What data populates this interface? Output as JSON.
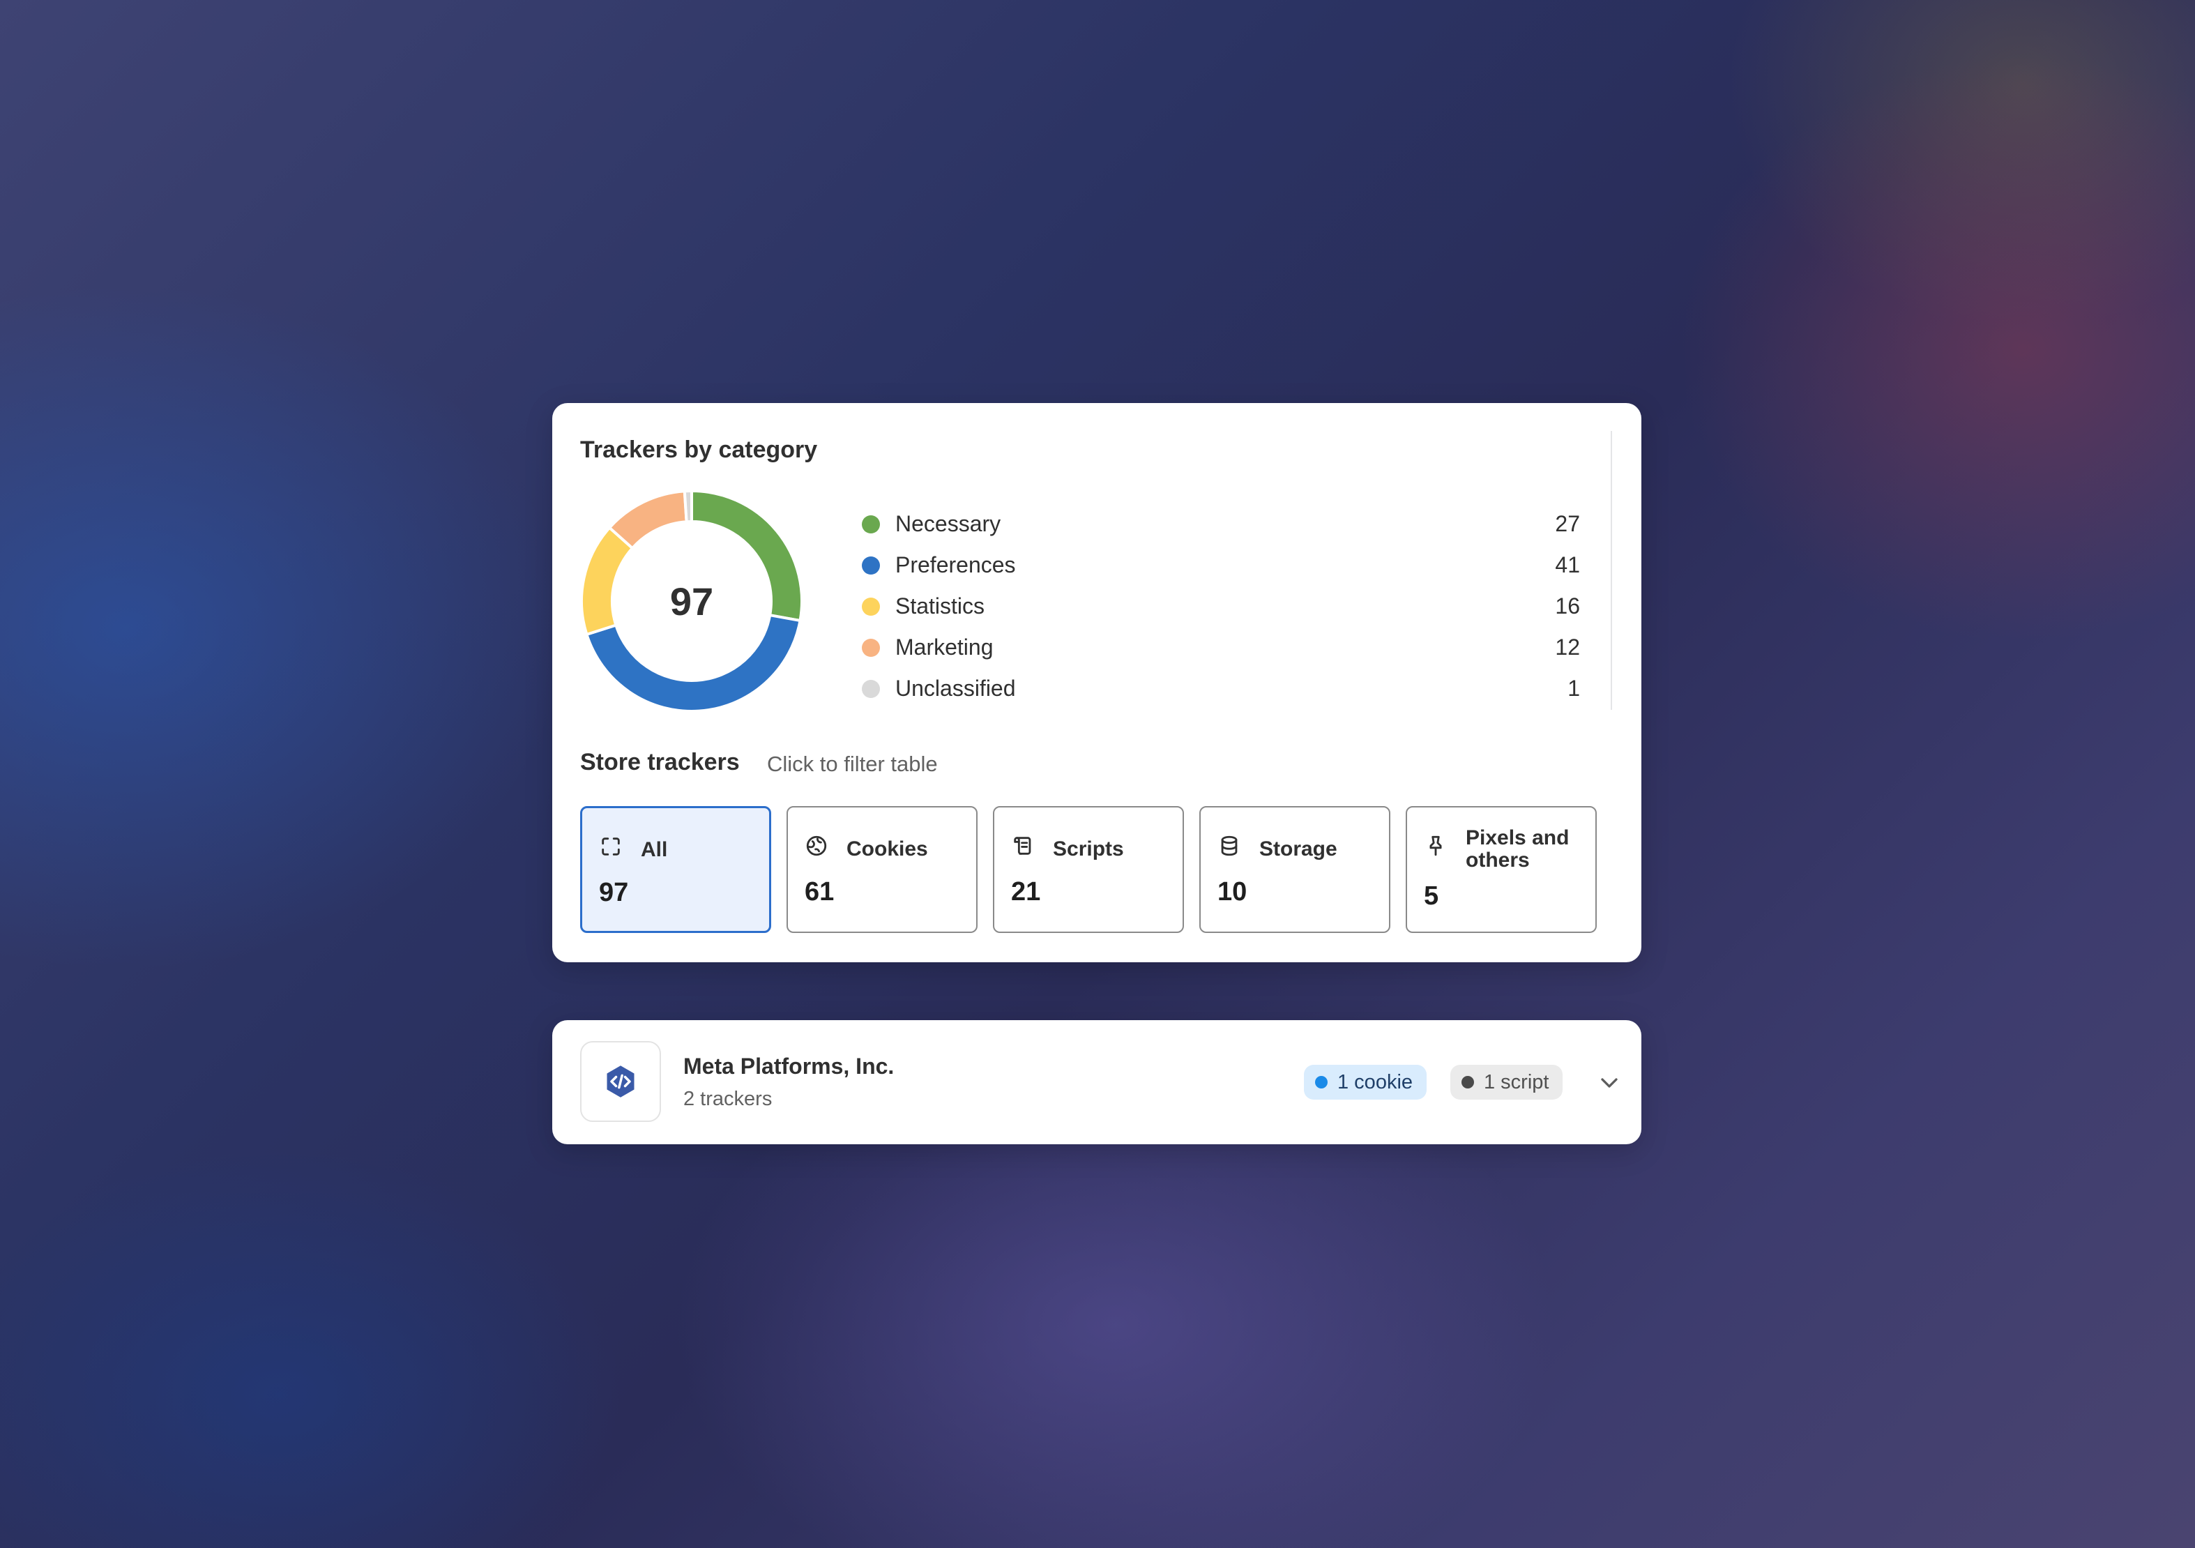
{
  "summary": {
    "title": "Trackers by category",
    "total": "97",
    "categories": [
      {
        "label": "Necessary",
        "count": "27",
        "value": 27,
        "color": "#6aa84f"
      },
      {
        "label": "Preferences",
        "count": "41",
        "value": 41,
        "color": "#2e73c4"
      },
      {
        "label": "Statistics",
        "count": "16",
        "value": 16,
        "color": "#fdd35c"
      },
      {
        "label": "Marketing",
        "count": "12",
        "value": 12,
        "color": "#f8b382"
      },
      {
        "label": "Unclassified",
        "count": "1",
        "value": 1,
        "color": "#d9d9d9"
      }
    ]
  },
  "store": {
    "title": "Store trackers",
    "hint": "Click to filter table",
    "tiles": [
      {
        "label": "All",
        "count": "97",
        "icon": "all-bracket-icon",
        "selected": true
      },
      {
        "label": "Cookies",
        "count": "61",
        "icon": "cookie-icon",
        "selected": false
      },
      {
        "label": "Scripts",
        "count": "21",
        "icon": "script-scroll-icon",
        "selected": false
      },
      {
        "label": "Storage",
        "count": "10",
        "icon": "database-icon",
        "selected": false
      },
      {
        "label": "Pixels and others",
        "count": "5",
        "icon": "pin-icon",
        "selected": false
      }
    ]
  },
  "vendor": {
    "name": "Meta Platforms, Inc.",
    "trackers": "2 trackers",
    "logo_icon": "code-hexagon-icon",
    "badges": [
      {
        "label": "1 cookie",
        "color": "#1a8ae8"
      },
      {
        "label": "1 script",
        "color": "#4a4a4a"
      }
    ],
    "expand_icon": "chevron-down-icon"
  }
}
